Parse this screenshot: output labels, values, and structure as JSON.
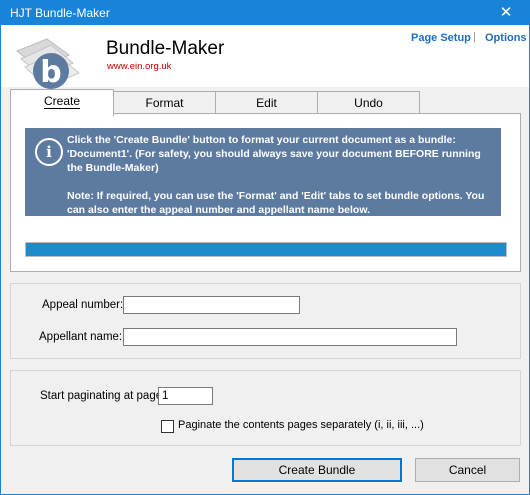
{
  "window": {
    "title": "HJT Bundle-Maker",
    "close_glyph": "✕"
  },
  "header": {
    "app_name": "Bundle-Maker",
    "url": "www.ein.org.uk",
    "links": {
      "page_setup": "Page Setup",
      "separator": "|",
      "options": "Options"
    },
    "logo_letter": "b"
  },
  "tabs": [
    {
      "label": "Create",
      "active": true
    },
    {
      "label": "Format",
      "active": false
    },
    {
      "label": "Edit",
      "active": false
    },
    {
      "label": "Undo",
      "active": false
    }
  ],
  "info": {
    "icon": "info-icon",
    "paragraph1": "Click the 'Create Bundle' button to format your current document as a bundle: 'Document1'. (For safety, you should always save your document BEFORE running the Bundle-Maker)",
    "paragraph2": "Note: If required, you can use the 'Format' and 'Edit' tabs to set bundle options. You can also enter the appeal number and appellant name below."
  },
  "progress": {
    "value_percent": 100,
    "color": "#1c8ccf"
  },
  "appeal": {
    "number_label": "Appeal number:",
    "number_value": "",
    "appellant_label": "Appellant name:",
    "appellant_value": ""
  },
  "pagination": {
    "start_label": "Start paginating at page:",
    "start_value": "1",
    "checkbox_label": "Paginate the contents pages separately (i, ii, iii, ...)",
    "checkbox_checked": false
  },
  "buttons": {
    "create": "Create Bundle",
    "cancel": "Cancel"
  },
  "colors": {
    "titlebar": "#1883d7",
    "info_bg": "#5d7aa1",
    "link": "#1f6fbf",
    "url": "#c00000"
  }
}
